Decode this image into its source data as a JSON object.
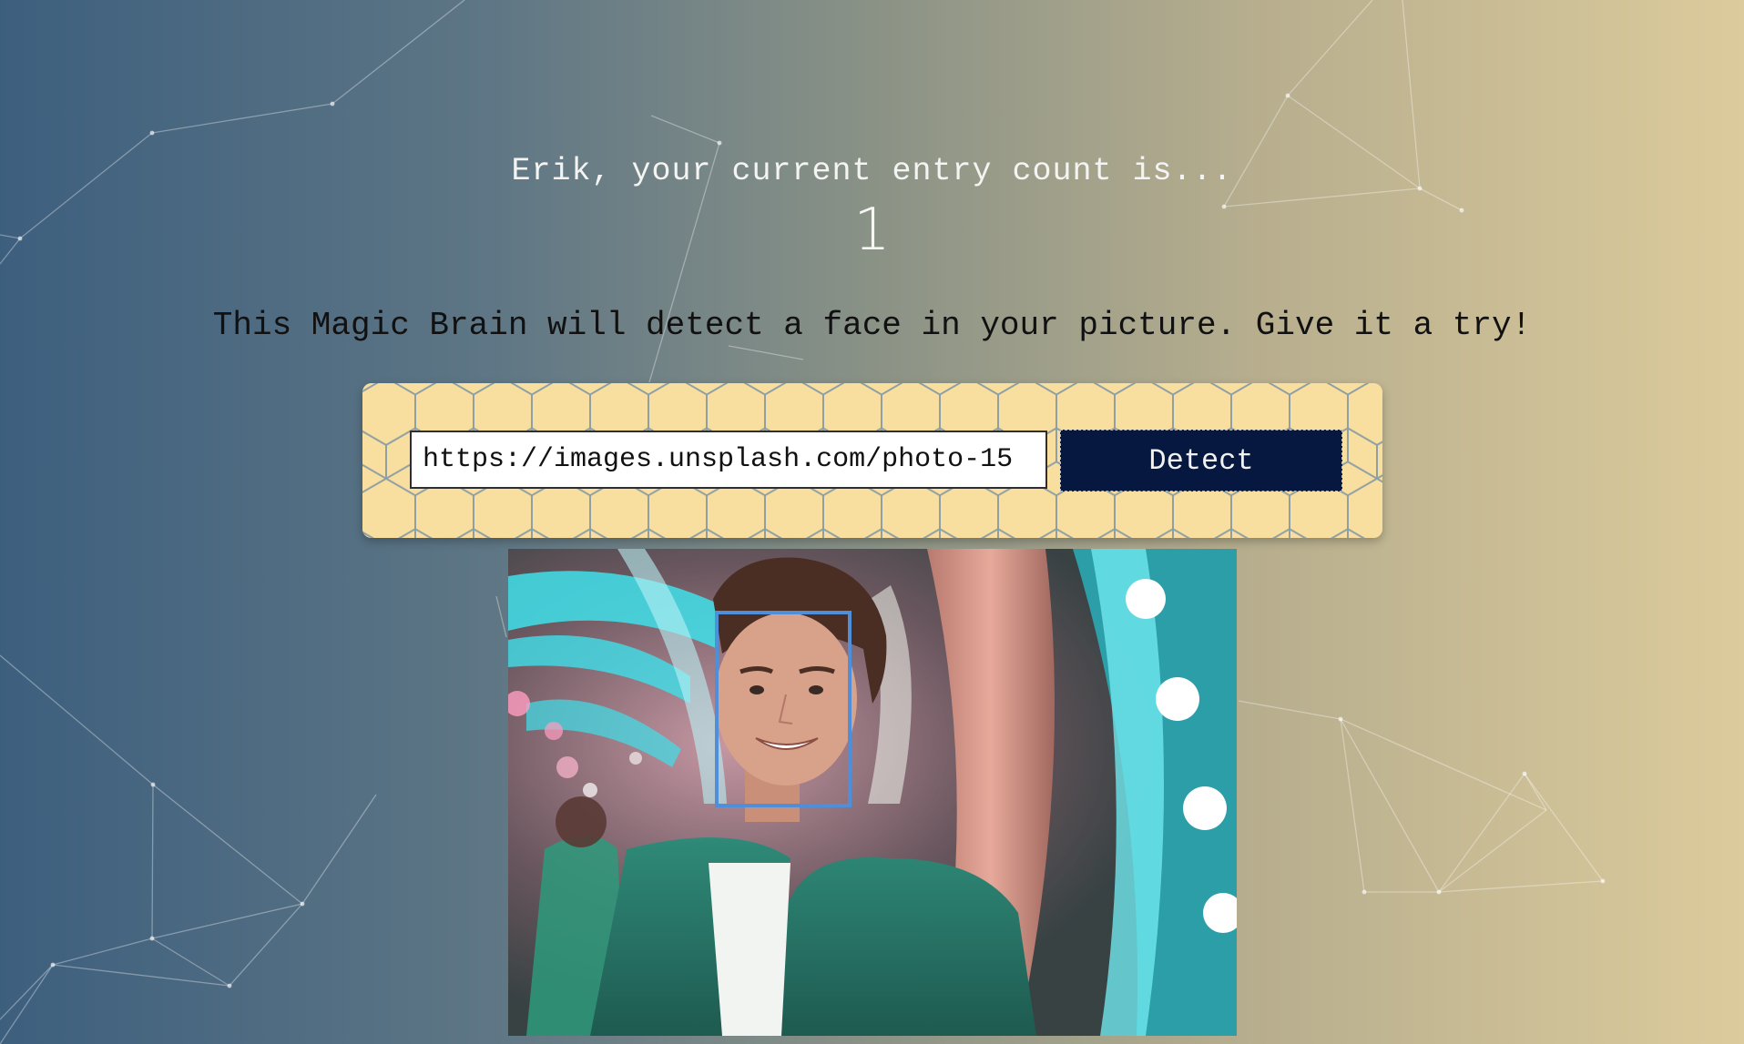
{
  "rank": {
    "message": "Erik, your current entry count is...",
    "count": "1"
  },
  "intro": {
    "text": "This Magic Brain will detect a face in your picture. Give it a try!"
  },
  "image_form": {
    "url_value": "https://images.unsplash.com/photo-15",
    "button_label": "Detect",
    "button_color": "#061840",
    "card_color": "#f8df9f"
  },
  "result": {
    "face_box_color": "#4f8ed8",
    "faces_detected": 1
  }
}
